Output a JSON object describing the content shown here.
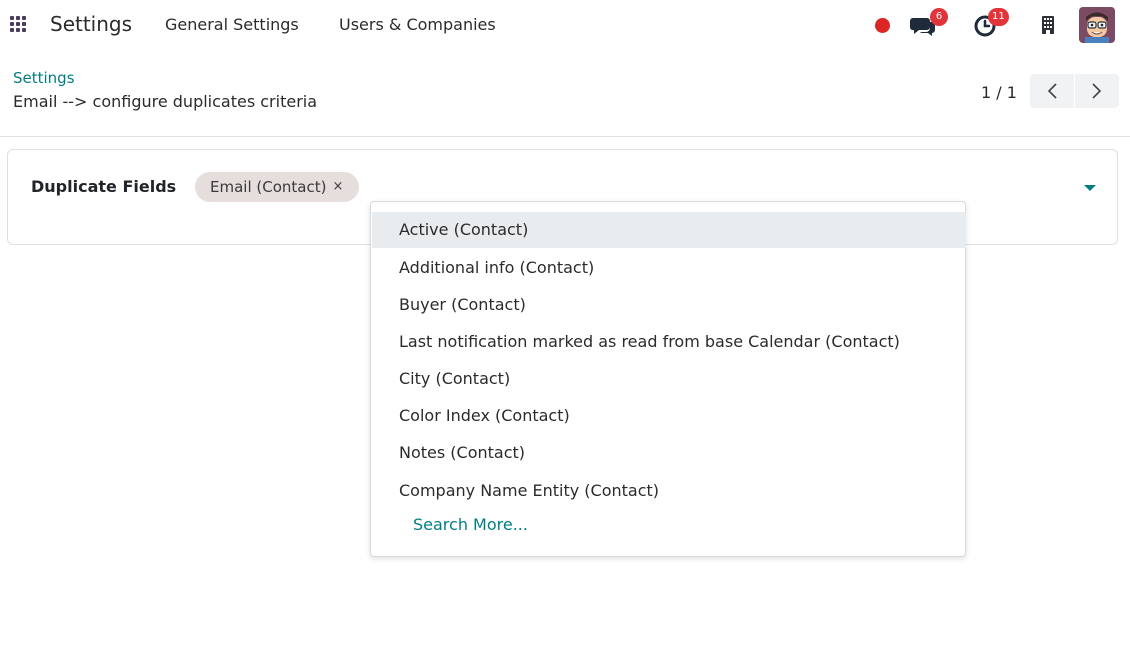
{
  "navbar": {
    "app_name": "Settings",
    "menu": [
      "General Settings",
      "Users & Companies"
    ],
    "chat_badge": "6",
    "activity_badge": "11",
    "status_color": "#dc2626"
  },
  "control_panel": {
    "breadcrumb": "Settings",
    "title": "Email --> configure duplicates criteria",
    "pager": "1 / 1"
  },
  "form": {
    "field_label": "Duplicate Fields",
    "tags": [
      "Email (Contact)"
    ],
    "tag_remove_glyph": "×"
  },
  "dropdown": {
    "items": [
      "Active (Contact)",
      "Additional info (Contact)",
      "Buyer (Contact)",
      "Last notification marked as read from base Calendar (Contact)",
      "City (Contact)",
      "Color Index (Contact)",
      "Notes (Contact)",
      "Company Name Entity (Contact)"
    ],
    "search_more": "Search More..."
  },
  "colors": {
    "accent": "#017e84",
    "badge": "#e0353a",
    "tag_bg": "#e6dedd"
  }
}
